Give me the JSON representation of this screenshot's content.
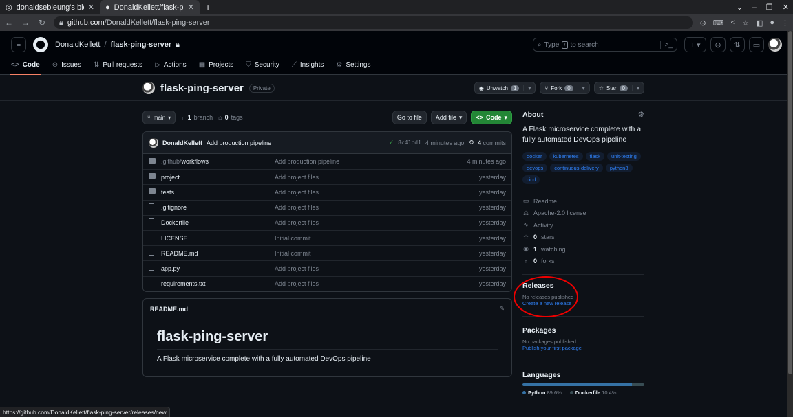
{
  "browser": {
    "tabs": [
      {
        "title": "donaldsebleung's blog",
        "icon": "globe-icon"
      },
      {
        "title": "DonaldKellett/flask-ping-s",
        "icon": "github-icon"
      }
    ],
    "url_host": "github.com",
    "url_path": "/DonaldKellett/flask-ping-server",
    "status_url": "https://github.com/DonaldKellett/flask-ping-server/releases/new"
  },
  "header": {
    "owner": "DonaldKellett",
    "repo": "flask-ping-server",
    "search_prefix": "Type",
    "search_key": "/",
    "search_suffix": "to search"
  },
  "repo_nav": [
    {
      "label": "Code",
      "icon": "code-icon"
    },
    {
      "label": "Issues",
      "icon": "issue-icon"
    },
    {
      "label": "Pull requests",
      "icon": "pr-icon"
    },
    {
      "label": "Actions",
      "icon": "play-icon"
    },
    {
      "label": "Projects",
      "icon": "table-icon"
    },
    {
      "label": "Security",
      "icon": "shield-icon"
    },
    {
      "label": "Insights",
      "icon": "graph-icon"
    },
    {
      "label": "Settings",
      "icon": "gear-icon"
    }
  ],
  "repo": {
    "name": "flask-ping-server",
    "visibility": "Private",
    "unwatch_label": "Unwatch",
    "watch_count": "1",
    "fork_label": "Fork",
    "fork_count": "0",
    "star_label": "Star",
    "star_count": "0"
  },
  "toolbar": {
    "branch": "main",
    "branch_count": "1",
    "branch_word": "branch",
    "tag_count": "0",
    "tag_word": "tags",
    "go_to_file": "Go to file",
    "add_file": "Add file",
    "code": "Code"
  },
  "latest_commit": {
    "author": "DonaldKellett",
    "message": "Add production pipeline",
    "sha": "8c41cd1",
    "time": "4 minutes ago",
    "commit_count": "4",
    "commit_word": "commits"
  },
  "files": [
    {
      "type": "folder",
      "name_prefix": ".github/",
      "name": "workflows",
      "message": "Add production pipeline",
      "date": "4 minutes ago"
    },
    {
      "type": "folder",
      "name_prefix": "",
      "name": "project",
      "message": "Add project files",
      "date": "yesterday"
    },
    {
      "type": "folder",
      "name_prefix": "",
      "name": "tests",
      "message": "Add project files",
      "date": "yesterday"
    },
    {
      "type": "file",
      "name_prefix": "",
      "name": ".gitignore",
      "message": "Add project files",
      "date": "yesterday"
    },
    {
      "type": "file",
      "name_prefix": "",
      "name": "Dockerfile",
      "message": "Add project files",
      "date": "yesterday"
    },
    {
      "type": "file",
      "name_prefix": "",
      "name": "LICENSE",
      "message": "Initial commit",
      "date": "yesterday"
    },
    {
      "type": "file",
      "name_prefix": "",
      "name": "README.md",
      "message": "Initial commit",
      "date": "yesterday"
    },
    {
      "type": "file",
      "name_prefix": "",
      "name": "app.py",
      "message": "Add project files",
      "date": "yesterday"
    },
    {
      "type": "file",
      "name_prefix": "",
      "name": "requirements.txt",
      "message": "Add project files",
      "date": "yesterday"
    }
  ],
  "readme": {
    "filename": "README.md",
    "heading": "flask-ping-server",
    "body": "A Flask microservice complete with a fully automated DevOps pipeline"
  },
  "about": {
    "title": "About",
    "description": "A Flask microservice complete with a fully automated DevOps pipeline",
    "topics": [
      "docker",
      "kubernetes",
      "flask",
      "unit-testing",
      "devops",
      "continuous-delivery",
      "python3",
      "cicd"
    ],
    "readme": "Readme",
    "license": "Apache-2.0 license",
    "activity": "Activity",
    "stars_count": "0",
    "stars_word": "stars",
    "watching_count": "1",
    "watching_word": "watching",
    "forks_count": "0",
    "forks_word": "forks"
  },
  "releases": {
    "title": "Releases",
    "empty": "No releases published",
    "link": "Create a new release"
  },
  "packages": {
    "title": "Packages",
    "empty": "No packages published",
    "link": "Publish your first package"
  },
  "languages": {
    "title": "Languages",
    "items": [
      {
        "name": "Python",
        "percent": "89.6%",
        "value": 89.6,
        "color": "#3572A5"
      },
      {
        "name": "Dockerfile",
        "percent": "10.4%",
        "value": 10.4,
        "color": "#384d54"
      }
    ]
  },
  "colors": {
    "accent": "#2f81f7",
    "green": "#238636",
    "annotation": "#ee0000"
  }
}
